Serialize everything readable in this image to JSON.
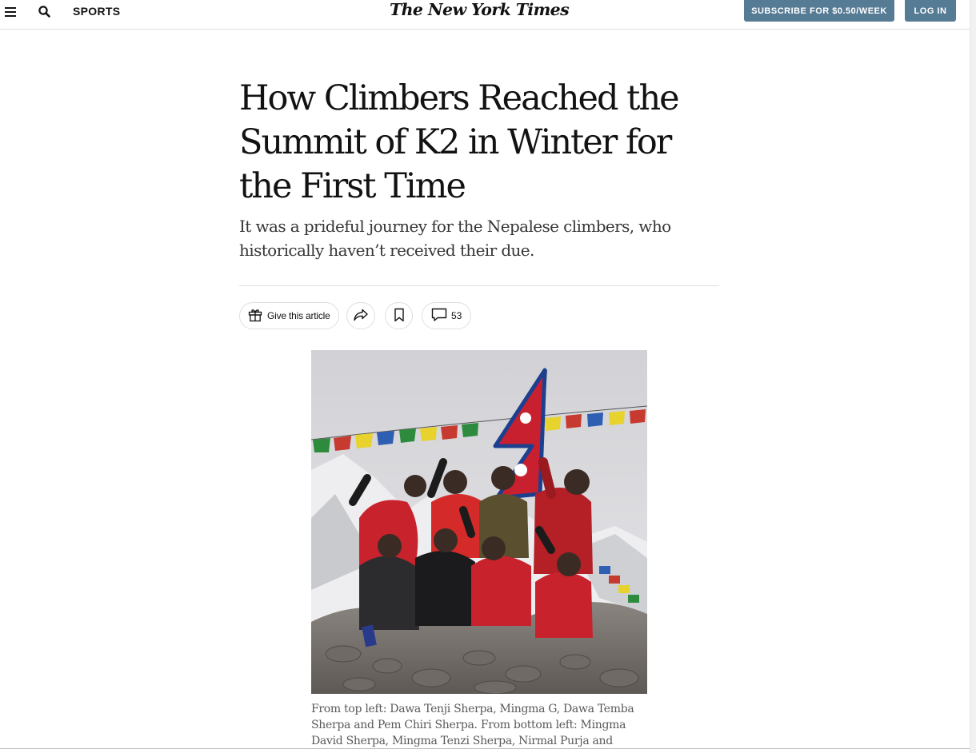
{
  "nav": {
    "section": "SPORTS",
    "masthead": "The New York Times",
    "subscribe_label": "SUBSCRIBE FOR $0.50/WEEK",
    "login_label": "LOG IN",
    "menu_icon": "hamburger-menu-icon",
    "search_icon": "search-icon"
  },
  "article": {
    "headline": "How Climbers Reached the Summit of K2 in Winter for the First Time",
    "summary": "It was a prideful journey for the Nepalese climbers, who historically haven’t received their due.",
    "actions": {
      "gift_label": "Give this article",
      "comment_count": "53",
      "gift_icon": "gift-icon",
      "share_icon": "share-arrow-icon",
      "save_icon": "bookmark-icon",
      "comment_icon": "speech-bubble-icon"
    },
    "photo": {
      "caption": "From top left: Dawa Tenji Sherpa, Mingma G, Dawa Temba Sherpa and Pem Chiri Sherpa. From bottom left: Mingma David Sherpa, Mingma Tenzi Sherpa, Nirmal Purja and"
    }
  },
  "colors": {
    "accent_button": "#567b95",
    "text": "#121212",
    "summary_text": "#363636",
    "caption_text": "#5a5a5a",
    "divider": "#dfdfdf"
  }
}
